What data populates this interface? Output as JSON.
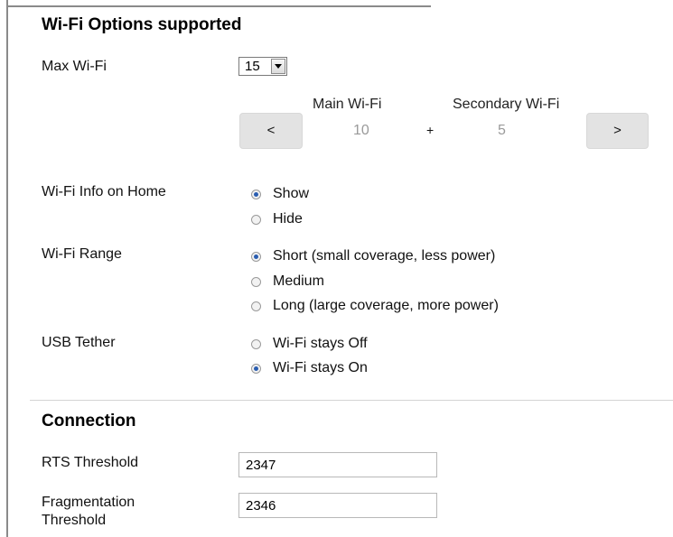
{
  "wifi_options": {
    "title": "Wi-Fi Options supported",
    "max_wifi_label": "Max Wi-Fi",
    "max_wifi_value": "15",
    "prev_label": "<",
    "next_label": ">",
    "main_wifi_label": "Main Wi-Fi",
    "main_wifi_value": "10",
    "plus": "+",
    "secondary_wifi_label": "Secondary Wi-Fi",
    "secondary_wifi_value": "5",
    "info_on_home": {
      "label": "Wi-Fi Info on Home",
      "options": [
        {
          "label": "Show",
          "checked": true
        },
        {
          "label": "Hide",
          "checked": false
        }
      ]
    },
    "range": {
      "label": "Wi-Fi Range",
      "options": [
        {
          "label": "Short (small coverage, less power)",
          "checked": true
        },
        {
          "label": "Medium",
          "checked": false
        },
        {
          "label": "Long (large coverage, more power)",
          "checked": false
        }
      ]
    },
    "usb_tether": {
      "label": "USB Tether",
      "options": [
        {
          "label": "Wi-Fi stays Off",
          "checked": false
        },
        {
          "label": "Wi-Fi stays On",
          "checked": true
        }
      ]
    }
  },
  "connection": {
    "title": "Connection",
    "rts_label": "RTS Threshold",
    "rts_value": "2347",
    "frag_label_line1": "Fragmentation",
    "frag_label_line2": "Threshold",
    "frag_value": "2346"
  },
  "colors": {
    "radio_dot": "#2a5db0",
    "button_bg": "#e3e3e3",
    "muted_value": "#9a9a9a"
  }
}
